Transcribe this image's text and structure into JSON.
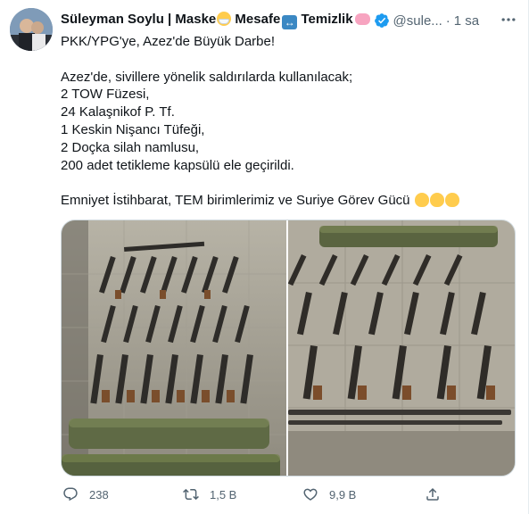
{
  "author": {
    "name": "Süleyman Soylu | Maske",
    "name_part2": " Mesafe",
    "name_part3": " Temizlik",
    "handle": "@sule...",
    "separator": "·",
    "time": "1 sa"
  },
  "tweet": {
    "line1": "PKK/YPG'ye, Azez'de Büyük Darbe!",
    "line2": "Azez'de, sivillere yönelik saldırılarda kullanılacak;",
    "line3": "2 TOW Füzesi,",
    "line4": "24 Kalaşnikof P. Tf.",
    "line5": "1 Keskin Nişancı Tüfeği,",
    "line6": "2 Doçka silah namlusu,",
    "line7": "200 adet tetikleme kapsülü ele geçirildi.",
    "line8": "Emniyet İstihbarat, TEM birimlerimiz ve Suriye Görev Gücü"
  },
  "icons": {
    "avatar": "profile-photo",
    "verified": "verified-badge-icon",
    "more": "more-options-icon",
    "reply": "reply-icon",
    "retweet": "retweet-icon",
    "like": "like-heart-icon",
    "share": "share-icon"
  },
  "stats": {
    "replies": "238",
    "retweets": "1,5 B",
    "likes": "9,9 B"
  },
  "colors": {
    "text": "#0f1419",
    "secondary": "#536471",
    "verified": "#1d9bf0",
    "border": "#cfd9de"
  }
}
